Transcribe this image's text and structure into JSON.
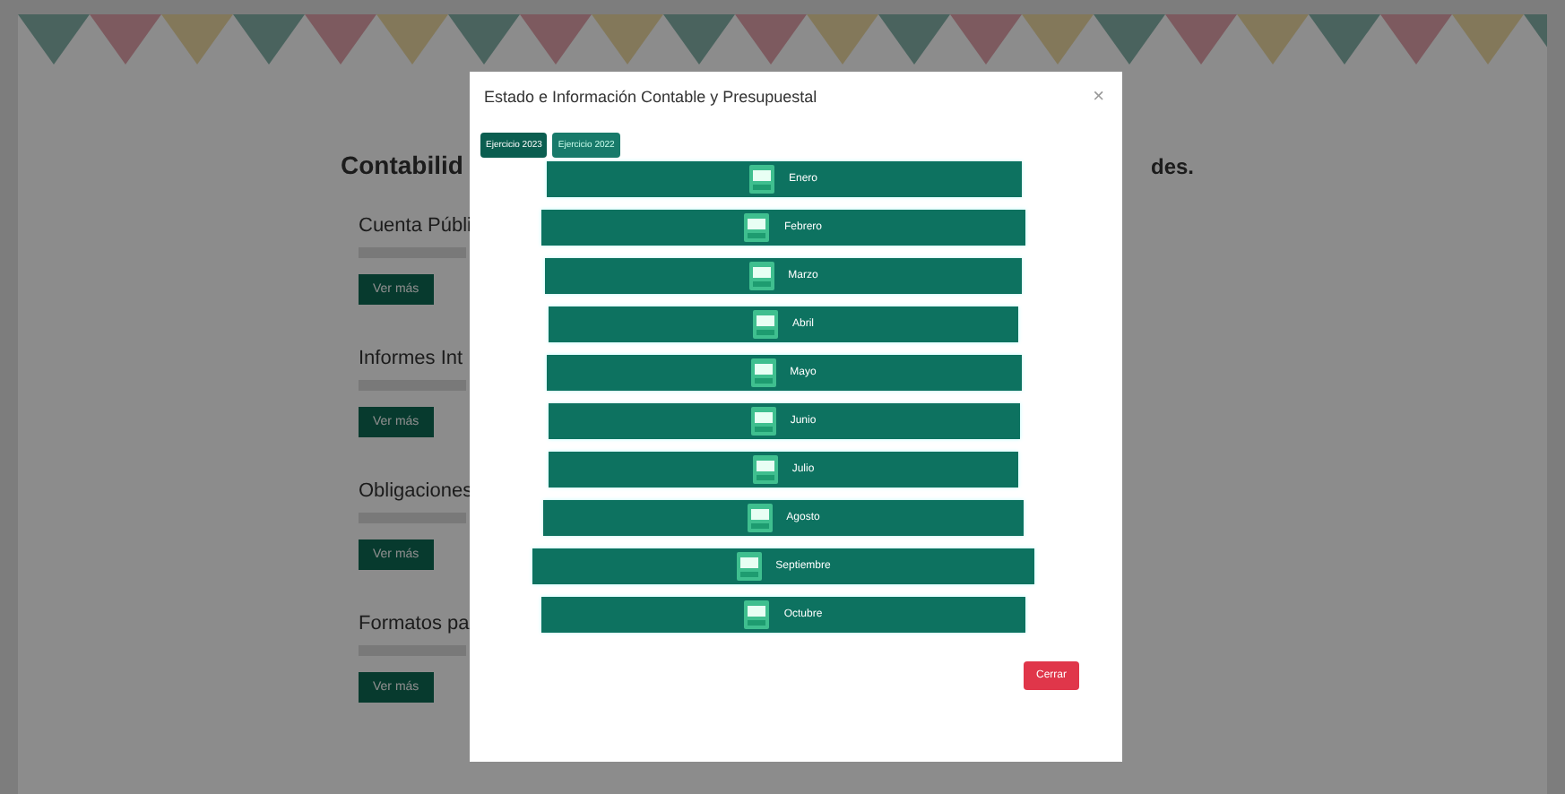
{
  "page": {
    "heading": "Contabilid",
    "right_heading": "des.",
    "sections": [
      {
        "title": "Cuenta Públi",
        "button": "Ver más"
      },
      {
        "title": "Informes Int",
        "button": "Ver más"
      },
      {
        "title": "Obligaciones",
        "button": "Ver más"
      },
      {
        "title": "Formatos pa",
        "button": "Ver más"
      }
    ]
  },
  "modal": {
    "title": "Estado e Información Contable y Presupuestal",
    "close": "×",
    "tabs": [
      {
        "label": "Ejercicio 2023",
        "selected": true
      },
      {
        "label": "Ejercicio 2022",
        "selected": false
      }
    ],
    "months": [
      "Enero",
      "Febrero",
      "Marzo",
      "Abril",
      "Mayo",
      "Junio",
      "Julio",
      "Agosto",
      "Septiembre",
      "Octubre"
    ],
    "footer_button": "Cerrar"
  }
}
